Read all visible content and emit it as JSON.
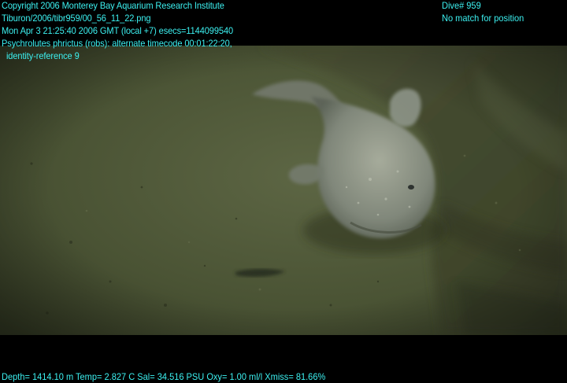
{
  "overlay": {
    "line1": "Copyright 2006 Monterey Bay Aquarium Research Institute",
    "line2": "Tiburon/2006/tibr959/00_56_11_22.png",
    "line3": "Mon Apr  3 21:25:40 2006 GMT (local +7)  esecs=1144099540",
    "line4": "Psychrolutes phrictus (robs): alternate timecode 00:01:22:20,",
    "line5": "  identity-reference 9",
    "dive": "Dive# 959",
    "position": "No match for position",
    "sensors": "Depth= 1414.10 m  Temp= 2.827 C  Sal= 34.516 PSU  Oxy= 1.00 ml/l  Xmiss= 81.66%"
  },
  "colors": {
    "overlay_text": "#3cf0f0",
    "letterbox": "#000000",
    "seafloor": "#4f5838",
    "fish": "#8a9080"
  }
}
